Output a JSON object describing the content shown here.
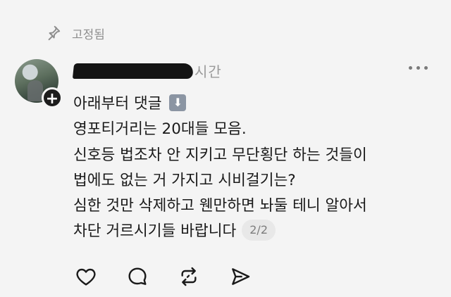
{
  "pinned": {
    "label": "고정됨",
    "icon": "pin-icon"
  },
  "post": {
    "avatar_icon": "plus-icon",
    "username_redacted": true,
    "time": "시간",
    "more_icon": "more-horizontal-icon",
    "lines": [
      "아래부터 댓글",
      "영포티거리는 20대들 모음.",
      "신호등 법조차 안 지키고 무단횡단 하는 것들이",
      "법에도 없는 거 가지고 시비걸기는?",
      "심한 것만 삭제하고 웬만하면 놔둘 테니 알아서",
      "차단 거르시기들 바랍니다"
    ],
    "arrow_emoji": "⬇",
    "page_indicator": "2/2"
  },
  "actions": [
    {
      "name": "like",
      "icon": "heart-icon"
    },
    {
      "name": "reply",
      "icon": "comment-icon"
    },
    {
      "name": "repost",
      "icon": "repost-icon"
    },
    {
      "name": "share",
      "icon": "send-icon"
    }
  ]
}
